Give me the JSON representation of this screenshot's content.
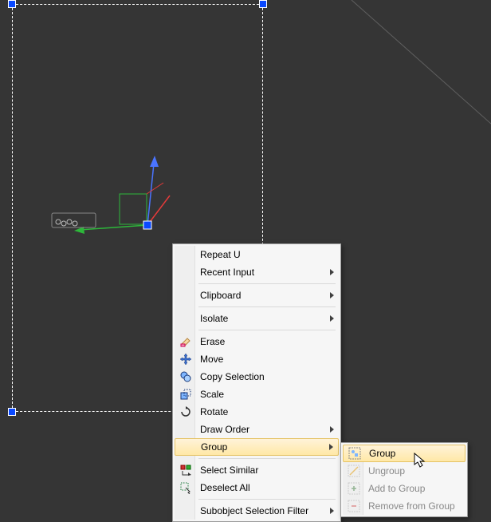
{
  "viewport": {
    "bg": "#353535"
  },
  "context_menu": {
    "items": [
      {
        "label": "Repeat U"
      },
      {
        "label": "Recent Input",
        "submenu": true
      },
      {
        "sep": true
      },
      {
        "label": "Clipboard",
        "submenu": true
      },
      {
        "sep": true
      },
      {
        "label": "Isolate",
        "submenu": true
      },
      {
        "sep": true
      },
      {
        "label": "Erase",
        "icon": "erase"
      },
      {
        "label": "Move",
        "icon": "move"
      },
      {
        "label": "Copy Selection",
        "icon": "copy-selection"
      },
      {
        "label": "Scale",
        "icon": "scale"
      },
      {
        "label": "Rotate",
        "icon": "rotate"
      },
      {
        "label": "Draw Order",
        "submenu": true
      },
      {
        "label": "Group",
        "submenu": true,
        "hovered": true
      },
      {
        "sep": true
      },
      {
        "label": "Select Similar",
        "icon": "select-similar"
      },
      {
        "label": "Deselect All",
        "icon": "deselect-all"
      },
      {
        "sep": true
      },
      {
        "label": "Subobject Selection Filter",
        "submenu": true
      }
    ]
  },
  "group_submenu": {
    "items": [
      {
        "label": "Group",
        "icon": "group",
        "hovered": true
      },
      {
        "label": "Ungroup",
        "icon": "ungroup",
        "disabled": true
      },
      {
        "label": "Add to Group",
        "icon": "add-to-group",
        "disabled": true
      },
      {
        "label": "Remove from Group",
        "icon": "remove-from-group",
        "disabled": true
      }
    ]
  }
}
